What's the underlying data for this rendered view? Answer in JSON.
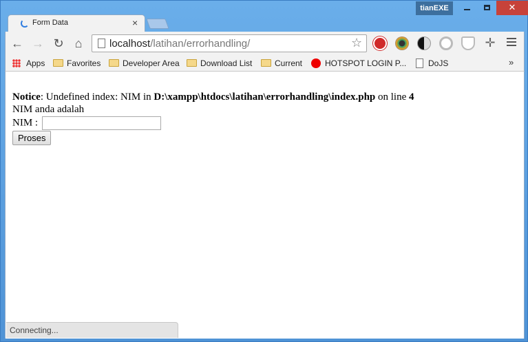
{
  "window": {
    "user_badge": "tianEXE",
    "controls": {
      "minimize": "",
      "maximize": "",
      "close": "✕"
    }
  },
  "tab": {
    "title": "Form Data",
    "close": "×"
  },
  "toolbar": {
    "back": "←",
    "forward": "→",
    "reload": "↻",
    "home": "⌂",
    "url_host": "localhost",
    "url_path": "/latihan/errorhandling/",
    "star": "☆",
    "move_icon": "✛"
  },
  "bookmarks": {
    "items": [
      {
        "label": "Apps",
        "icon": "apps-icon"
      },
      {
        "label": "Favorites",
        "icon": "folder-icon"
      },
      {
        "label": "Developer Area",
        "icon": "folder-icon"
      },
      {
        "label": "Download List",
        "icon": "folder-icon"
      },
      {
        "label": "Current",
        "icon": "folder-icon"
      },
      {
        "label": "HOTSPOT LOGIN P...",
        "icon": "hotspot-icon"
      },
      {
        "label": "DoJS",
        "icon": "document-icon"
      }
    ],
    "overflow": "»"
  },
  "page": {
    "notice_label": "Notice",
    "notice_text_1": ": Undefined index: NIM in ",
    "notice_path": "D:\\xampp\\htdocs\\latihan\\errorhandling\\index.php",
    "notice_text_2": " on line ",
    "notice_line": "4",
    "nim_output": "NIM anda adalah",
    "nim_label": "NIM :",
    "nim_value": "",
    "submit_label": "Proses"
  },
  "status": {
    "text": "Connecting..."
  }
}
